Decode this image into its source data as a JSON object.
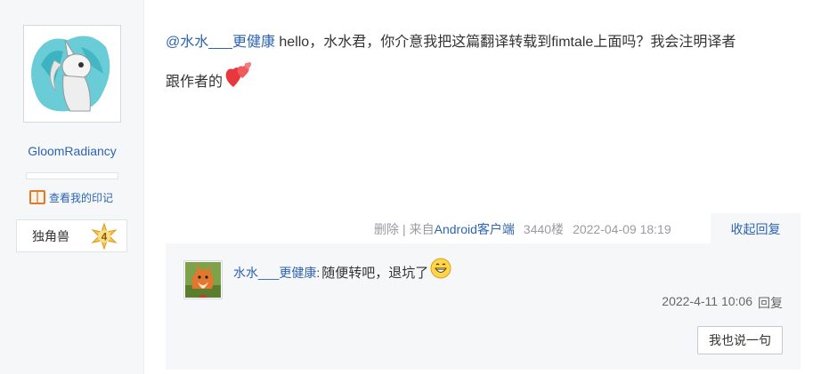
{
  "author": {
    "username": "GloomRadiancy",
    "imprint_label": "查看我的印记",
    "badge_label": "独角兽",
    "badge_level": "4",
    "avatar_icon": "pony-avatar-icon"
  },
  "post": {
    "mention": "@水水___更健康",
    "text_line1": " hello，水水君，你介意我把这篇翻译转载到fimtale上面吗？我会注明译者",
    "text_line2": "跟作者的",
    "emoji": "hearts-icon"
  },
  "tail": {
    "delete": "删除",
    "separator": "|",
    "source_prefix": "来自",
    "client": "Android客户端",
    "floor": "3440楼",
    "datetime": "2022-04-09 18:19",
    "collapse": "收起回复"
  },
  "reply": {
    "username": "水水___更健康",
    "colon": ":",
    "text": " 随便转吧，退坑了",
    "emoji": "grin-icon",
    "datetime": "2022-4-11 10:06",
    "reply_label": "回复",
    "say_button": "我也说一句"
  },
  "colors": {
    "link": "#2d64b3",
    "muted": "#9a9ca2",
    "panel": "#f6f7f9"
  }
}
